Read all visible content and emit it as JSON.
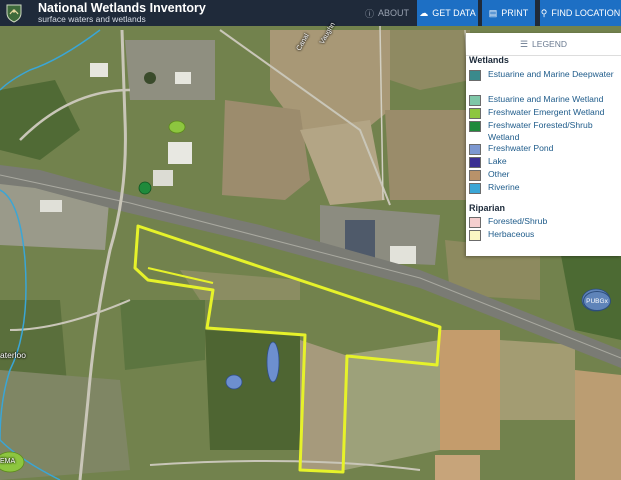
{
  "header": {
    "title": "National Wetlands Inventory",
    "subtitle": "surface waters and wetlands",
    "logo_icon": "fws-shield-icon",
    "nav": [
      {
        "label": "ABOUT",
        "icon": "info-circle-icon"
      },
      {
        "label": "GET DATA",
        "icon": "cloud-download-icon"
      },
      {
        "label": "PRINT",
        "icon": "printer-icon"
      },
      {
        "label": "FIND LOCATION",
        "icon": "search-icon"
      }
    ]
  },
  "legend": {
    "title": "LEGEND",
    "icon": "list-icon",
    "sections": [
      {
        "title": "Wetlands",
        "items": [
          {
            "label": "Estuarine and Marine Deepwater",
            "color": "#3a8a8c"
          },
          {
            "label": "Estuarine and Marine Wetland",
            "color": "#7fc7a8"
          },
          {
            "label": "Freshwater Emergent Wetland",
            "color": "#8dc63f"
          },
          {
            "label": "Freshwater Forested/Shrub Wetland",
            "color": "#1f8a3b"
          },
          {
            "label": "Freshwater Pond",
            "color": "#7c97d0"
          },
          {
            "label": "Lake",
            "color": "#3b2f93"
          },
          {
            "label": "Other",
            "color": "#b8926a"
          },
          {
            "label": "Riverine",
            "color": "#3aa6d6"
          }
        ]
      },
      {
        "title": "Riparian",
        "items": [
          {
            "label": "Forested/Shrub",
            "color": "#f5cfcf"
          },
          {
            "label": "Herbaceous",
            "color": "#fbf6c3"
          }
        ]
      }
    ]
  },
  "map": {
    "labels": [
      "Canal",
      "Vaughn",
      "aterloo",
      "PUBGx",
      "EMA"
    ],
    "parcel_outline_color": "#e6f22a"
  }
}
